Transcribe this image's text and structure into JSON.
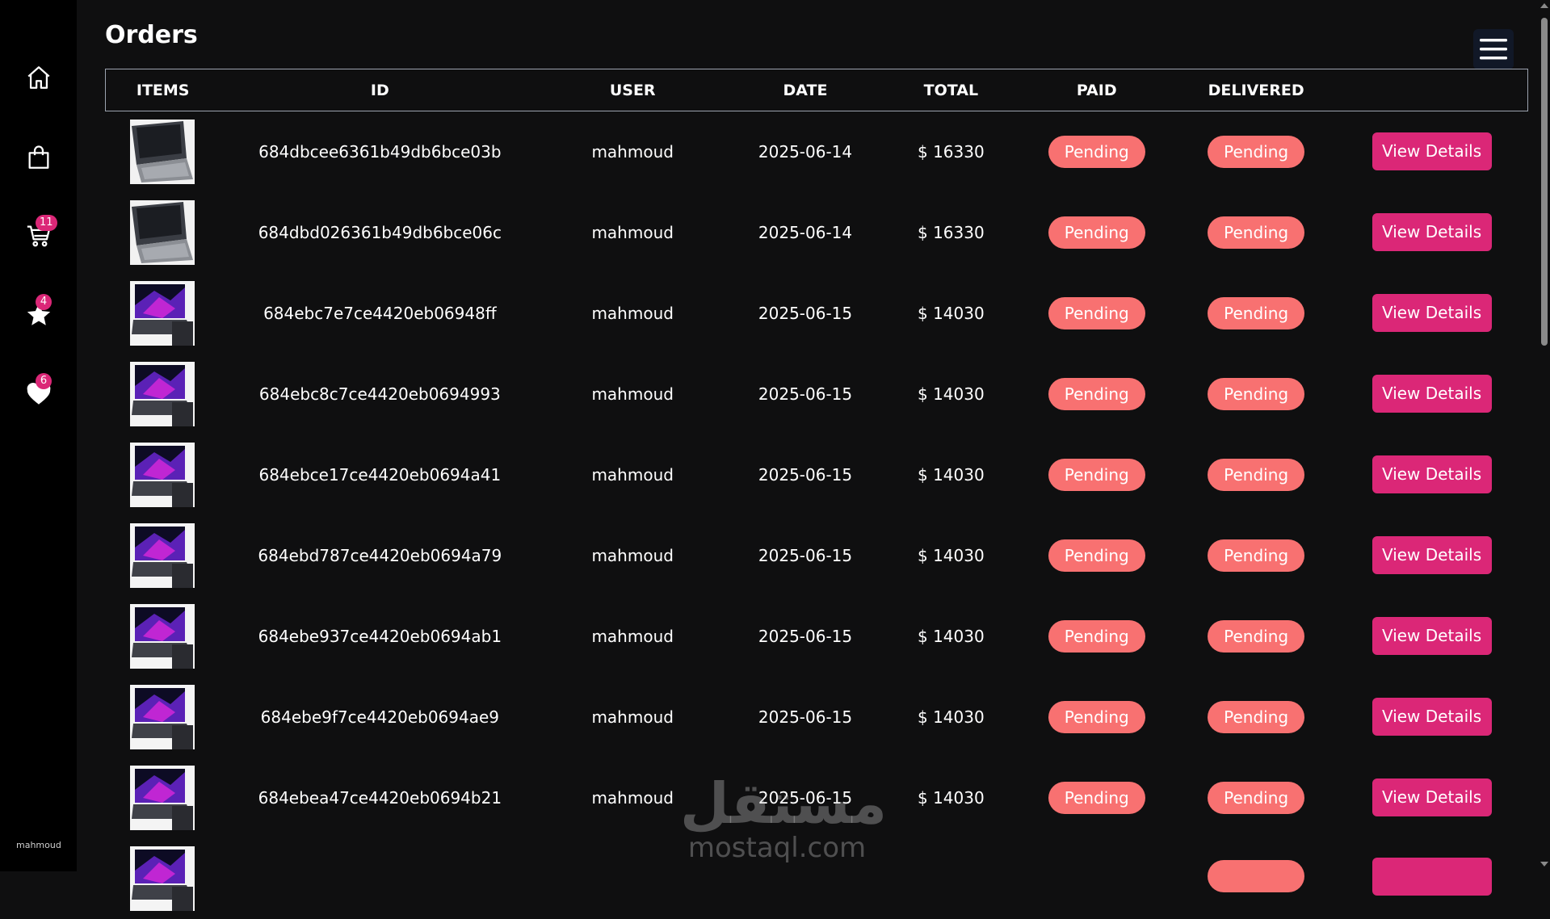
{
  "sidebar": {
    "cart_badge": "11",
    "favorites_badge": "4",
    "wishlist_badge": "6",
    "username": "mahmoud",
    "icons": [
      "home-icon",
      "shopping-bag-icon",
      "cart-icon",
      "star-icon",
      "heart-icon"
    ]
  },
  "page": {
    "title": "Orders"
  },
  "table": {
    "headers": [
      "ITEMS",
      "ID",
      "USER",
      "DATE",
      "TOTAL",
      "PAID",
      "DELIVERED",
      ""
    ],
    "rows": [
      {
        "id": "684dbcee6361b49db6bce03b",
        "user": "mahmoud",
        "date": "2025-06-14",
        "total": "$ 16330",
        "paid": "Pending",
        "delivered": "Pending",
        "action": "View Details",
        "image": "laptop-silver"
      },
      {
        "id": "684dbd026361b49db6bce06c",
        "user": "mahmoud",
        "date": "2025-06-14",
        "total": "$ 16330",
        "paid": "Pending",
        "delivered": "Pending",
        "action": "View Details",
        "image": "laptop-silver"
      },
      {
        "id": "684ebc7e7ce4420eb06948ff",
        "user": "mahmoud",
        "date": "2025-06-15",
        "total": "$ 14030",
        "paid": "Pending",
        "delivered": "Pending",
        "action": "View Details",
        "image": "laptop-purple"
      },
      {
        "id": "684ebc8c7ce4420eb0694993",
        "user": "mahmoud",
        "date": "2025-06-15",
        "total": "$ 14030",
        "paid": "Pending",
        "delivered": "Pending",
        "action": "View Details",
        "image": "laptop-purple"
      },
      {
        "id": "684ebce17ce4420eb0694a41",
        "user": "mahmoud",
        "date": "2025-06-15",
        "total": "$ 14030",
        "paid": "Pending",
        "delivered": "Pending",
        "action": "View Details",
        "image": "laptop-purple"
      },
      {
        "id": "684ebd787ce4420eb0694a79",
        "user": "mahmoud",
        "date": "2025-06-15",
        "total": "$ 14030",
        "paid": "Pending",
        "delivered": "Pending",
        "action": "View Details",
        "image": "laptop-purple"
      },
      {
        "id": "684ebe937ce4420eb0694ab1",
        "user": "mahmoud",
        "date": "2025-06-15",
        "total": "$ 14030",
        "paid": "Pending",
        "delivered": "Pending",
        "action": "View Details",
        "image": "laptop-purple"
      },
      {
        "id": "684ebe9f7ce4420eb0694ae9",
        "user": "mahmoud",
        "date": "2025-06-15",
        "total": "$ 14030",
        "paid": "Pending",
        "delivered": "Pending",
        "action": "View Details",
        "image": "laptop-purple"
      },
      {
        "id": "684ebea47ce4420eb0694b21",
        "user": "mahmoud",
        "date": "2025-06-15",
        "total": "$ 14030",
        "paid": "Pending",
        "delivered": "Pending",
        "action": "View Details",
        "image": "laptop-purple"
      },
      {
        "id": "",
        "user": "",
        "date": "",
        "total": "",
        "paid": "",
        "delivered": "",
        "action": "",
        "image": "laptop-purple"
      }
    ]
  },
  "watermark": {
    "arabic": "مستقل",
    "latin": "mostaql.com"
  },
  "colors": {
    "accent": "#db2777",
    "pending": "#f87171",
    "background": "#0f0f10",
    "sidebar": "#000000"
  }
}
